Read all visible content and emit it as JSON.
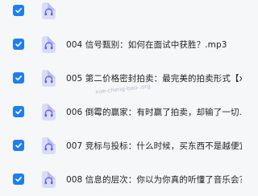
{
  "files": [
    {
      "name": "",
      "checked": true
    },
    {
      "name": "004 信号甄别：如何在面试中获胜？.mp3",
      "checked": true
    },
    {
      "name": "005 第二价格密封拍卖：最完美的拍卖形式【xue-",
      "checked": true
    },
    {
      "name": "006 倒霉的赢家：有时赢了拍卖，却输了一切.mp3",
      "checked": true
    },
    {
      "name": "007 竞标与投标：什么时候，买东西不是越便宜越",
      "checked": true
    },
    {
      "name": "008 信息的层次：你以为你真的听懂了音乐会？.",
      "checked": true
    }
  ],
  "watermark": "xue-cheng-bao-.org"
}
